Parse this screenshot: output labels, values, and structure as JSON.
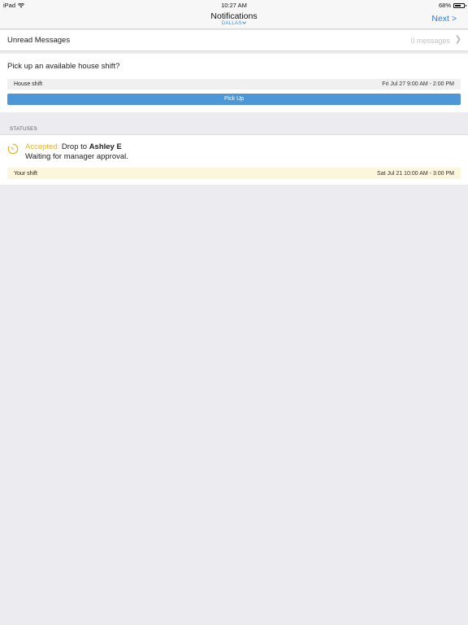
{
  "status_bar": {
    "device": "iPad",
    "time": "10:27 AM",
    "battery_percent": "68%",
    "battery_level": 0.68
  },
  "nav": {
    "title": "Notifications",
    "subtitle": "DALLAS",
    "next_label": "Next >"
  },
  "unread": {
    "label": "Unread Messages",
    "count": "0 messages",
    "chevron": "❯"
  },
  "pickup": {
    "question": "Pick up an available house shift?",
    "shift_label": "House shift",
    "shift_time": "Fri Jul 27 9:00 AM - 2:00 PM",
    "button_label": "Pick Up"
  },
  "statuses": {
    "header": "STATUSES",
    "items": [
      {
        "status": "Accepted:",
        "action": " Drop to ",
        "person": "Ashley E",
        "detail": "Waiting for manager approval.",
        "shift_label": "Your shift",
        "shift_time": "Sat Jul 21 10:00 AM - 3:00 PM",
        "icon": "clock-pending-icon"
      }
    ]
  },
  "colors": {
    "accent_blue": "#2f7bd8",
    "button_blue": "#4e97d6",
    "accepted_yellow": "#e8b339",
    "shift_highlight": "#fcf6dc",
    "background": "#ebebf0"
  }
}
